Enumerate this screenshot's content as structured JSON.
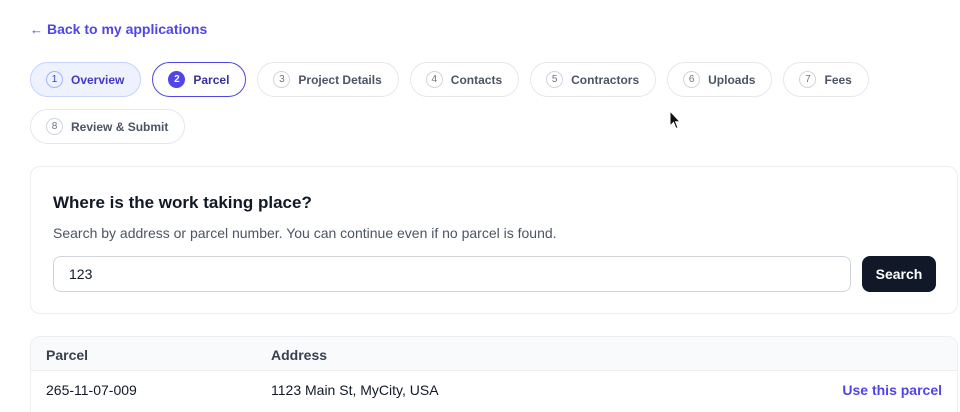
{
  "nav": {
    "back_arrow": "←",
    "back_label": "Back to my applications"
  },
  "steps": [
    {
      "number": "1",
      "label": "Overview",
      "state": "done"
    },
    {
      "number": "2",
      "label": "Parcel",
      "state": "active"
    },
    {
      "number": "3",
      "label": "Project Details",
      "state": "pending"
    },
    {
      "number": "4",
      "label": "Contacts",
      "state": "pending"
    },
    {
      "number": "5",
      "label": "Contractors",
      "state": "pending"
    },
    {
      "number": "6",
      "label": "Uploads",
      "state": "pending"
    },
    {
      "number": "7",
      "label": "Fees",
      "state": "pending"
    },
    {
      "number": "8",
      "label": "Review & Submit",
      "state": "pending"
    }
  ],
  "search_card": {
    "title": "Where is the work taking place?",
    "description": "Search by address or parcel number. You can continue even if no parcel is found.",
    "input_value": "123",
    "button_label": "Search"
  },
  "results": {
    "headers": {
      "parcel": "Parcel",
      "address": "Address"
    },
    "rows": [
      {
        "parcel": "265-11-07-009",
        "address": "1123 Main St, MyCity, USA",
        "action": "Use this parcel"
      }
    ]
  },
  "colors": {
    "accent": "#4f46e5",
    "button_dark": "#111827"
  }
}
